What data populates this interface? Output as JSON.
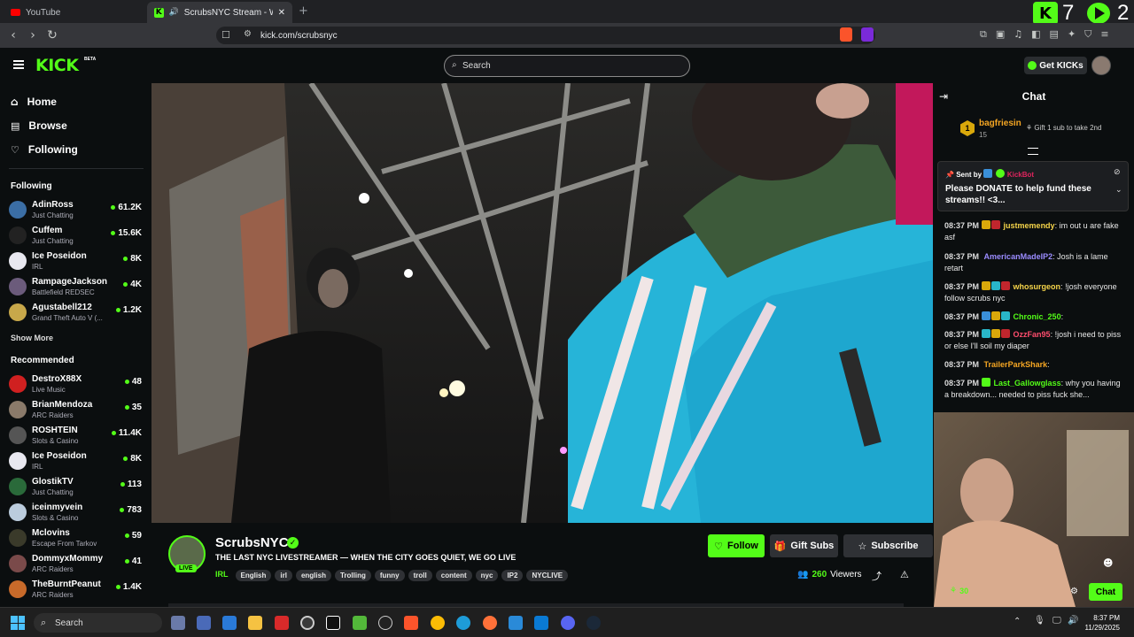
{
  "browser": {
    "tabs": [
      {
        "title": "YouTube",
        "active": false
      },
      {
        "title": "ScrubsNYC Stream - Watch Li...",
        "active": true
      }
    ],
    "url": "kick.com/scrubsnyc",
    "overlay_numbers": [
      "7",
      "2"
    ]
  },
  "header": {
    "logo": "KICK",
    "beta": "BETA",
    "search_placeholder": "Search",
    "get_kicks": "Get KICKs"
  },
  "sidebar": {
    "nav": [
      {
        "label": "Home",
        "icon": "home-icon"
      },
      {
        "label": "Browse",
        "icon": "browse-icon"
      },
      {
        "label": "Following",
        "icon": "heart-icon"
      }
    ],
    "following_heading": "Following",
    "following": [
      {
        "name": "AdinRoss",
        "category": "Just Chatting",
        "viewers": "61.2K",
        "color": "#3b6ea5"
      },
      {
        "name": "Cuffem",
        "category": "Just Chatting",
        "viewers": "15.6K",
        "color": "#222222"
      },
      {
        "name": "Ice Poseidon",
        "category": "IRL",
        "viewers": "8K",
        "color": "#e8e8f0"
      },
      {
        "name": "RampageJackson",
        "category": "Battlefield REDSEC",
        "viewers": "4K",
        "color": "#6b5b7b"
      },
      {
        "name": "Agustabell212",
        "category": "Grand Theft Auto V (...",
        "viewers": "1.2K",
        "color": "#c8a84a"
      }
    ],
    "show_more": "Show More",
    "recommended_heading": "Recommended",
    "recommended": [
      {
        "name": "DestroX88X",
        "category": "Live Music",
        "viewers": "48",
        "color": "#d02020"
      },
      {
        "name": "BrianMendoza",
        "category": "ARC Raiders",
        "viewers": "35",
        "color": "#8a7a6a"
      },
      {
        "name": "ROSHTEIN",
        "category": "Slots & Casino",
        "viewers": "11.4K",
        "color": "#555555"
      },
      {
        "name": "Ice Poseidon",
        "category": "IRL",
        "viewers": "8K",
        "color": "#e8e8f0"
      },
      {
        "name": "GlostikTV",
        "category": "Just Chatting",
        "viewers": "113",
        "color": "#2a6a3a"
      },
      {
        "name": "iceinmyvein",
        "category": "Slots & Casino",
        "viewers": "783",
        "color": "#bcd"
      },
      {
        "name": "Mclovins",
        "category": "Escape From Tarkov",
        "viewers": "59",
        "color": "#3a3a2a"
      },
      {
        "name": "DommyxMommy",
        "category": "ARC Raiders",
        "viewers": "41",
        "color": "#7a4a4a"
      },
      {
        "name": "TheBurntPeanut",
        "category": "ARC Raiders",
        "viewers": "1.4K",
        "color": "#c86a2a"
      }
    ]
  },
  "stream": {
    "channel": "ScrubsNYC",
    "live_label": "LIVE",
    "title": "THE LAST NYC LIVESTREAMER — WHEN THE CITY GOES QUIET, WE GO LIVE",
    "category": "IRL",
    "tags": [
      "English",
      "irl",
      "english",
      "Trolling",
      "funny",
      "troll",
      "content",
      "nyc",
      "IP2",
      "NYCLIVE"
    ],
    "follow": "Follow",
    "gift_subs": "Gift Subs",
    "subscribe": "Subscribe",
    "viewers": "260",
    "viewers_label": "Viewers"
  },
  "chat": {
    "title": "Chat",
    "top_gifter": {
      "rank": "1",
      "name": "bagfriesin",
      "count": "15",
      "cta": "Gift 1 sub to take 2nd"
    },
    "pinned": {
      "sent_by": "Sent by",
      "bot": "KickBot",
      "text": "Please DONATE to help fund these streams!! <3..."
    },
    "messages": [
      {
        "time": "08:37 PM",
        "user": "justmemendy",
        "color": "#f5d44a",
        "text": "im out u are fake asf"
      },
      {
        "time": "08:37 PM",
        "user": "AmericanMadeIP2",
        "color": "#9b8cff",
        "text": "Josh is a lame retart"
      },
      {
        "time": "08:37 PM",
        "user": "whosurgeon",
        "color": "#f5d44a",
        "text": "!josh everyone follow scrubs nyc"
      },
      {
        "time": "08:37 PM",
        "user": "Chronic_250",
        "color": "#53fc18",
        "text": ""
      },
      {
        "time": "08:37 PM",
        "user": "OzzFan95",
        "color": "#ff4d6d",
        "text": "!josh i need to piss or else I'll soil my diaper"
      },
      {
        "time": "08:37 PM",
        "user": "TrailerParkShark",
        "color": "#f5a623",
        "text": ""
      },
      {
        "time": "08:37 PM",
        "user": "Last_Gallowglass",
        "color": "#53fc18",
        "text": "why you having a breakdown... needed to piss fuck she..."
      }
    ],
    "points": "30",
    "chat_button": "Chat"
  },
  "taskbar": {
    "search": "Search",
    "time": "8:37 PM",
    "date": "11/29/2025"
  }
}
